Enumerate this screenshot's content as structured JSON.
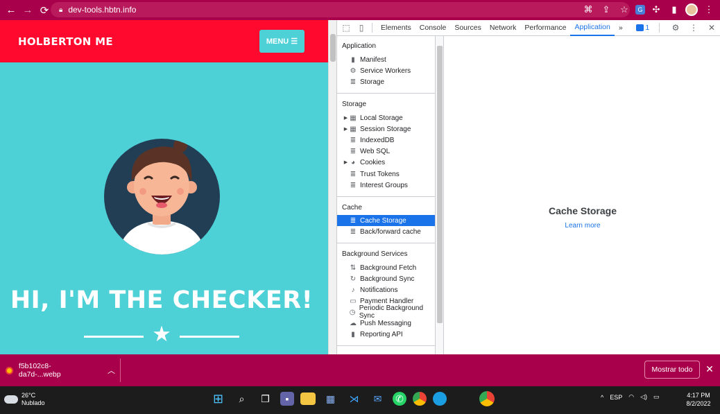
{
  "browser": {
    "url": "dev-tools.hbtn.info",
    "accent": "#a8004a"
  },
  "site": {
    "logo": "HOLBERTON ME",
    "menu_label": "MENU",
    "hero_title": "HI, I'M THE CHECKER!",
    "header_color": "#ff0a2e",
    "bg_color": "#4dd0d6"
  },
  "devtools": {
    "tabs": [
      "Elements",
      "Console",
      "Sources",
      "Network",
      "Performance",
      "Application"
    ],
    "active_tab": "Application",
    "more_tabs": "»",
    "issues_count": "1",
    "sections": {
      "application": {
        "title": "Application",
        "items": [
          {
            "label": "Manifest",
            "icon": "file-icon"
          },
          {
            "label": "Service Workers",
            "icon": "gear-icon"
          },
          {
            "label": "Storage",
            "icon": "database-icon"
          }
        ]
      },
      "storage": {
        "title": "Storage",
        "items": [
          {
            "label": "Local Storage",
            "icon": "grid-icon",
            "expandable": true
          },
          {
            "label": "Session Storage",
            "icon": "grid-icon",
            "expandable": true
          },
          {
            "label": "IndexedDB",
            "icon": "database-icon"
          },
          {
            "label": "Web SQL",
            "icon": "database-icon"
          },
          {
            "label": "Cookies",
            "icon": "cookie-icon",
            "expandable": true
          },
          {
            "label": "Trust Tokens",
            "icon": "database-icon"
          },
          {
            "label": "Interest Groups",
            "icon": "database-icon"
          }
        ]
      },
      "cache": {
        "title": "Cache",
        "items": [
          {
            "label": "Cache Storage",
            "icon": "database-icon",
            "selected": true
          },
          {
            "label": "Back/forward cache",
            "icon": "database-icon"
          }
        ]
      },
      "background": {
        "title": "Background Services",
        "items": [
          {
            "label": "Background Fetch",
            "icon": "arrows-icon"
          },
          {
            "label": "Background Sync",
            "icon": "sync-icon"
          },
          {
            "label": "Notifications",
            "icon": "bell-icon"
          },
          {
            "label": "Payment Handler",
            "icon": "card-icon"
          },
          {
            "label": "Periodic Background Sync",
            "icon": "clock-icon"
          },
          {
            "label": "Push Messaging",
            "icon": "cloud-icon"
          },
          {
            "label": "Reporting API",
            "icon": "file-icon"
          }
        ]
      }
    },
    "main": {
      "title": "Cache Storage",
      "link": "Learn more"
    }
  },
  "download_bar": {
    "file_name": "f5b102c8-da7d-...webp",
    "show_all": "Mostrar todo"
  },
  "taskbar": {
    "temperature": "26°C",
    "weather": "Nublado",
    "language": "ESP",
    "time": "4:17 PM",
    "date": "8/2/2022"
  }
}
